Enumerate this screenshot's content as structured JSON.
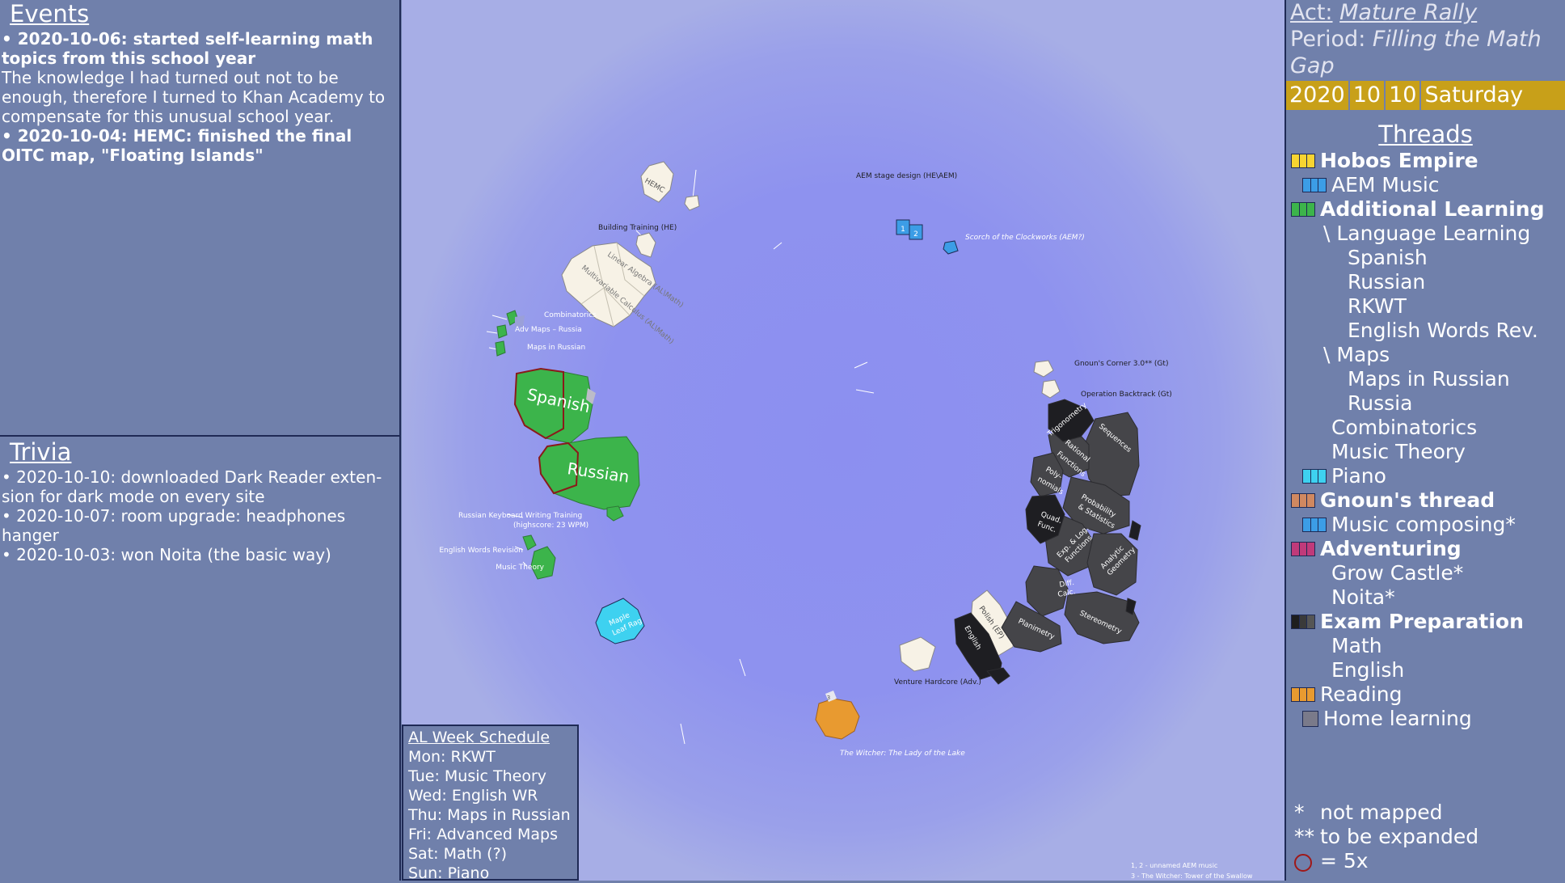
{
  "events": {
    "title": "Events",
    "entries": [
      {
        "head": "• 2020-10-06: started self-learning math topics from this school year",
        "body": "The knowledge I had turned out not to be enough, therefore I turned to Khan Academy to compensate for this unusual school year."
      },
      {
        "head": "• 2020-10-04: HEMC: finished the final OITC map, \"Floating Islands\"",
        "body": ""
      }
    ]
  },
  "trivia": {
    "title": "Trivia",
    "entries": [
      "• 2020-10-10: downloaded Dark Reader exten-sion for dark mode on every site",
      "• 2020-10-07: room upgrade: headphones hanger",
      "• 2020-10-03: won Noita (the basic way)"
    ]
  },
  "schedule": {
    "title": "AL Week Schedule",
    "rows": [
      "Mon: RKWT",
      "Tue: Music Theory",
      "Wed: English WR",
      "Thu: Maps in Russian",
      "Fri: Advanced Maps",
      "Sat: Math (?)",
      "Sun: Piano"
    ]
  },
  "header": {
    "act_label": "Act:",
    "act_name": "Mature Rally",
    "period_label": "Period:",
    "period_name": "Filling the Math Gap",
    "date": {
      "year": "2020",
      "month": "10",
      "day": "10",
      "weekday": "Saturday"
    },
    "date_bar_color": "#c8a019"
  },
  "threads": {
    "title": "Threads",
    "items": [
      {
        "label": "Hobos Empire",
        "bold": true,
        "indent": 0,
        "colors": [
          "#f7d431",
          "#f7d431",
          "#f7d431"
        ]
      },
      {
        "label": "AEM Music",
        "bold": false,
        "indent": 1,
        "colors": [
          "#3c9de6",
          "#3c9de6",
          "#3c9de6"
        ]
      },
      {
        "label": "Additional Learning",
        "bold": true,
        "indent": 0,
        "colors": [
          "#3cb44b",
          "#3cb44b",
          "#3cb44b"
        ]
      },
      {
        "label": "\\ Language Learning",
        "bold": false,
        "indent": 2,
        "colors": []
      },
      {
        "label": "Spanish",
        "bold": false,
        "indent": 3,
        "colors": []
      },
      {
        "label": "Russian",
        "bold": false,
        "indent": 3,
        "colors": []
      },
      {
        "label": "RKWT",
        "bold": false,
        "indent": 3,
        "colors": []
      },
      {
        "label": "English Words Rev.",
        "bold": false,
        "indent": 3,
        "colors": []
      },
      {
        "label": "\\ Maps",
        "bold": false,
        "indent": 2,
        "colors": []
      },
      {
        "label": "Maps in Russian",
        "bold": false,
        "indent": 3,
        "colors": []
      },
      {
        "label": "Russia",
        "bold": false,
        "indent": 3,
        "colors": []
      },
      {
        "label": "Combinatorics",
        "bold": false,
        "indent": 1,
        "colors": []
      },
      {
        "label": "Music Theory",
        "bold": false,
        "indent": 1,
        "colors": []
      },
      {
        "label": "Piano",
        "bold": false,
        "indent": 1,
        "colors": [
          "#3ed1f0",
          "#3ed1f0",
          "#3ed1f0"
        ]
      },
      {
        "label": "Gnoun's thread",
        "bold": true,
        "indent": 0,
        "colors": [
          "#d08860",
          "#d08860",
          "#d08860"
        ]
      },
      {
        "label": "Music composing*",
        "bold": false,
        "indent": 1,
        "colors": [
          "#3c9de6",
          "#3c9de6",
          "#3c9de6"
        ]
      },
      {
        "label": "Adventuring",
        "bold": true,
        "indent": 0,
        "colors": [
          "#c03a7a",
          "#c03a7a",
          "#c03a7a"
        ]
      },
      {
        "label": "Grow Castle*",
        "bold": false,
        "indent": 1,
        "colors": []
      },
      {
        "label": "Noita*",
        "bold": false,
        "indent": 1,
        "colors": []
      },
      {
        "label": "Exam Preparation",
        "bold": true,
        "indent": 0,
        "colors": [
          "#1e1e1e",
          "#3a3a3a",
          "#555555"
        ]
      },
      {
        "label": "Math",
        "bold": false,
        "indent": 1,
        "colors": []
      },
      {
        "label": "English",
        "bold": false,
        "indent": 1,
        "colors": []
      },
      {
        "label": "Reading",
        "bold": false,
        "indent": 0,
        "colors": [
          "#e89a30",
          "#e89a30",
          "#e89a30"
        ]
      },
      {
        "label": "Home learning",
        "bold": false,
        "indent": 1,
        "colors": [
          "#7a7a8a"
        ],
        "single": true
      }
    ]
  },
  "legend": {
    "not_mapped_sym": "*",
    "not_mapped": "not mapped",
    "expand_sym": "**",
    "expand": "to be expanded",
    "circle_text": "= 5x"
  },
  "map": {
    "labels": {
      "hemc": "HEMC",
      "aem_stage": "AEM stage design (HE\\AEM)",
      "building": "Building Training (HE)",
      "linear_algebra": "Linear Algebra (AL\\Math)",
      "multivariable": "Multivariable Calculus (AL\\Math)",
      "scorch": "Scorch of the Clockworks (AEM?)",
      "combinatorics": "Combinatorics",
      "adv_maps": "Adv Maps – Russia",
      "maps_russian": "Maps in Russian",
      "spanish": "Spanish",
      "russian": "Russian",
      "rkwt_1": "Russian Keyboard Writing Training",
      "rkwt_2": "(highscore: 23 WPM)",
      "english_words": "English Words Revision",
      "music_theory": "Music Theory",
      "maple_1": "Maple",
      "maple_2": "Leaf Rag",
      "gnoun": "Gnoun's Corner 3.0** (Gt)",
      "backtrack": "Operation Backtrack (Gt)",
      "trig": "Trigonometry",
      "sequences": "Sequences",
      "rational_1": "Rational",
      "rational_2": "Functions",
      "poly_1": "Poly-",
      "poly_2": "nomials",
      "prob_1": "Probability",
      "prob_2": "& Statistics",
      "quad_1": "Quad.",
      "quad_2": "Func.",
      "exp_1": "Exp. & Log.",
      "exp_2": "Functions",
      "analytic_1": "Analytic",
      "analytic_2": "Geometry",
      "diff_1": "Diff.",
      "diff_2": "Calc.",
      "stereo": "Stereometry",
      "plani": "Planimetry",
      "polish": "Polish (EP)",
      "english": "English",
      "venture": "Venture Hardcore (Adv.)",
      "witcher": "The Witcher: The Lady of the Lake",
      "aem1": "1",
      "aem2": "2",
      "w3": "3",
      "footnote_1": "1, 2 - unnamed AEM music",
      "footnote_2": "3 - The Witcher: Tower of the Swallow"
    },
    "colors": {
      "cream": "#f7f2e6",
      "green": "#3cb44b",
      "dark": "#454549",
      "black": "#1e1e22",
      "cyan": "#3ed1f0",
      "orange": "#e89a30",
      "blue": "#3c9de6"
    }
  }
}
